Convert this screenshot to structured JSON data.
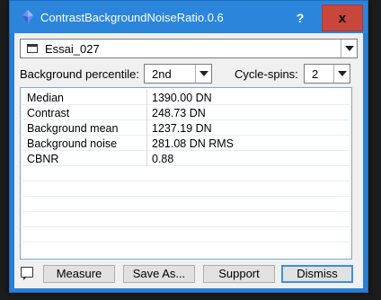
{
  "window": {
    "title": "ContrastBackgroundNoiseRatio.0.6",
    "help_label": "?",
    "close_label": "x"
  },
  "image_select": {
    "value": "Essai_027"
  },
  "options": {
    "percentile_label": "Background percentile:",
    "percentile_value": "2nd",
    "cycles_label": "Cycle-spins:",
    "cycles_value": "2"
  },
  "results": {
    "rows": [
      {
        "key": "Median",
        "value": "1390.00 DN"
      },
      {
        "key": "Contrast",
        "value": "248.73 DN"
      },
      {
        "key": "Background mean",
        "value": "1237.19 DN"
      },
      {
        "key": "Background noise",
        "value": "281.08 DN RMS"
      },
      {
        "key": "CBNR",
        "value": "0.88"
      }
    ]
  },
  "buttons": {
    "measure": "Measure",
    "save_as": "Save As...",
    "support": "Support",
    "dismiss": "Dismiss"
  },
  "colors": {
    "titlebar": "#2b86db",
    "close": "#c9463d",
    "dialog_bg": "#f0f0f0"
  }
}
